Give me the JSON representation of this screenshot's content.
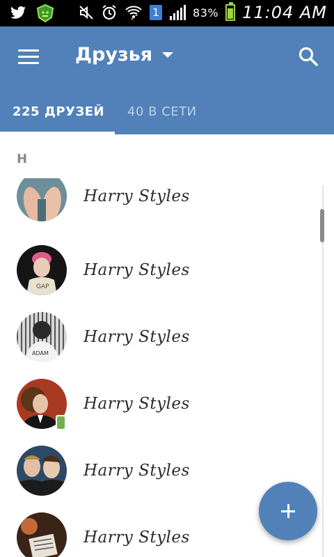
{
  "status_bar": {
    "left_icons": [
      "twitter-icon",
      "android-shield-icon"
    ],
    "right_icons": [
      "mute-icon",
      "alarm-icon",
      "wifi-icon",
      "notification-badge-icon",
      "signal-icon",
      "battery-icon"
    ],
    "notification_badge": "1",
    "battery_percent": "83%",
    "battery_level": 0.83,
    "time": "11:04 AM"
  },
  "app_bar": {
    "title": "Друзья",
    "menu_icon": "hamburger-menu-icon",
    "dropdown_icon": "caret-down-icon",
    "search_icon": "search-icon",
    "color": "#5181b8"
  },
  "tabs": {
    "friends": "225 ДРУЗЕЙ",
    "online": "40 В СЕТИ",
    "active": "friends"
  },
  "section": {
    "letter": "Н"
  },
  "friends": [
    {
      "name": "Harry Styles",
      "mobile": false
    },
    {
      "name": "Harry Styles",
      "mobile": false
    },
    {
      "name": "Harry Styles",
      "mobile": false
    },
    {
      "name": "Harry Styles",
      "mobile": true
    },
    {
      "name": "Harry Styles",
      "mobile": false
    },
    {
      "name": "Harry Styles",
      "mobile": false
    }
  ],
  "fab": {
    "icon": "plus-icon"
  }
}
